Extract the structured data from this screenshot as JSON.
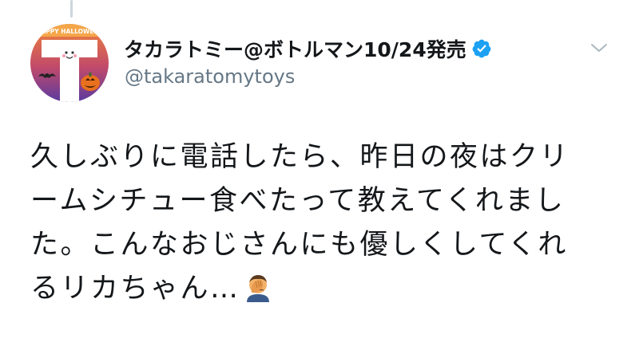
{
  "tweet": {
    "display_name": "タカラトミー@ボトルマン10/24発売",
    "handle": "@takaratomytoys",
    "verified": true,
    "avatar": {
      "banner_text": "HAPPY HALLOWEEN",
      "letter": "T",
      "icons": [
        "bat-icon",
        "jack-o-lantern-icon"
      ]
    },
    "menu_icon": "chevron-down-icon",
    "text_lines": [
      "久しぶりに電話したら、昨日の夜はクリ",
      "ームシチュー食べたって教えてくれまし",
      "た。こんなおじさんにも優しくしてくれ",
      "るリカちゃん…"
    ],
    "trailing_emoji": "face-palm-emoji"
  },
  "colors": {
    "text": "#14171a",
    "secondary": "#657786",
    "verified_blue": "#1da1f2",
    "avatar_orange": "#e8643c",
    "avatar_purple": "#5a3aa0"
  }
}
